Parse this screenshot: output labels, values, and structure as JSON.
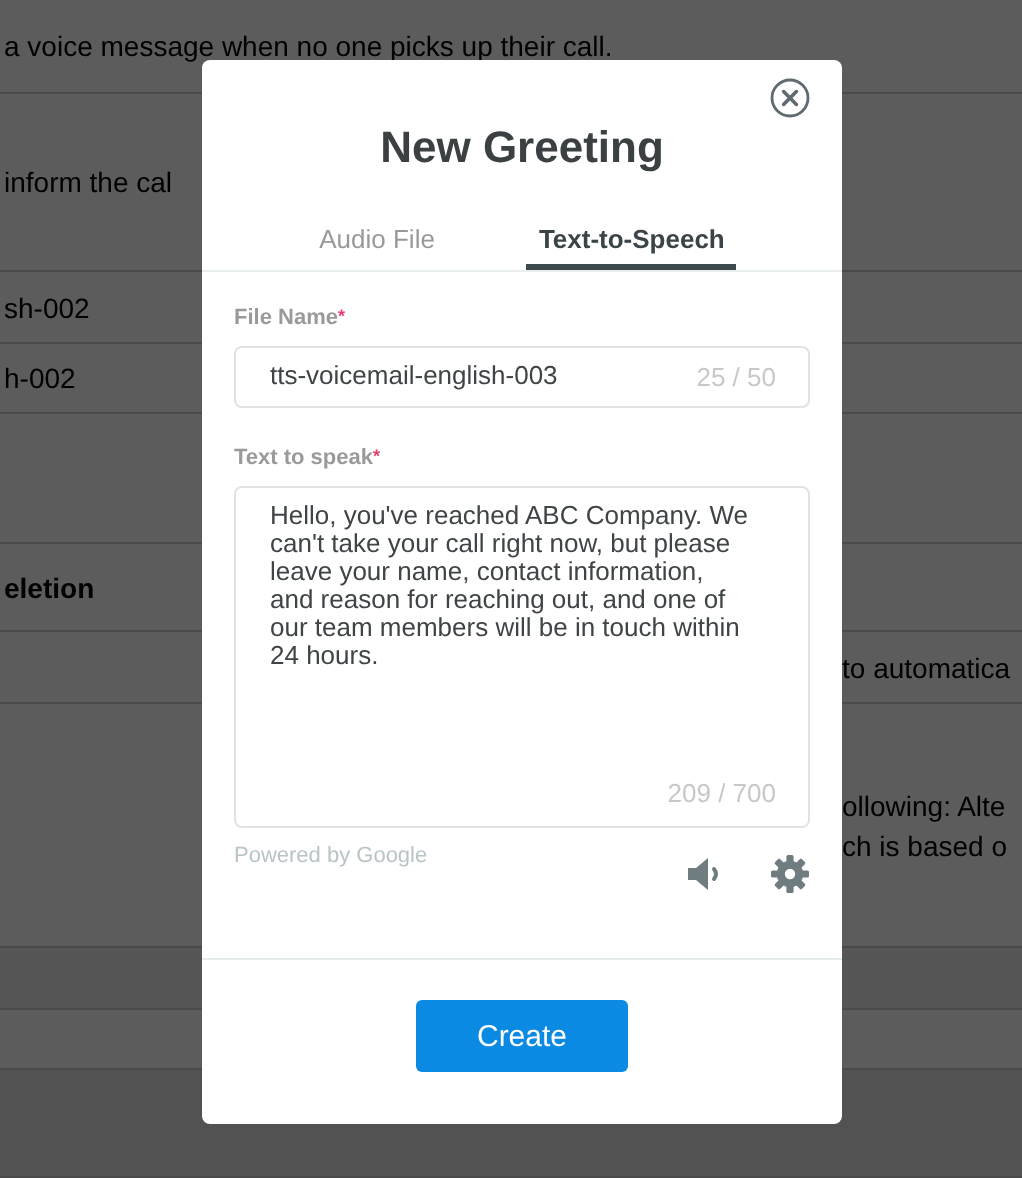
{
  "background": {
    "rows": [
      {
        "left": {
          "text": "a voice message when no one picks up their call.",
          "bold": false
        }
      },
      {
        "left": {
          "text": "inform the cal",
          "bold": false
        }
      },
      {
        "left": {
          "text": "sh-002",
          "bold": false
        }
      },
      {
        "left": {
          "text": "h-002",
          "bold": false
        }
      },
      {},
      {
        "left": {
          "text": "eletion",
          "bold": true
        }
      },
      {
        "right": [
          "to automatica"
        ]
      },
      {
        "right": [
          "ollowing: Alte",
          "ch is based o"
        ]
      },
      {},
      {},
      {}
    ]
  },
  "dialog": {
    "title": "New Greeting",
    "tabs": [
      {
        "label": "Audio File",
        "selected": false
      },
      {
        "label": "Text-to-Speech",
        "selected": true
      }
    ],
    "fields": [
      {
        "kind": "input",
        "label": "File Name",
        "required_mark": "*",
        "value": "tts-voicemail-english-003",
        "counter": "25 / 50"
      },
      {
        "kind": "textarea",
        "label": "Text to speak",
        "required_mark": "*",
        "value": "Hello, you've reached ABC Company. We can't take your call right now, but please leave your name, contact information, and reason for reaching out, and one of our team members will be in touch within 24 hours.",
        "counter": "209 / 700"
      }
    ],
    "powered_by": "Powered by Google",
    "primary_button": "Create"
  }
}
